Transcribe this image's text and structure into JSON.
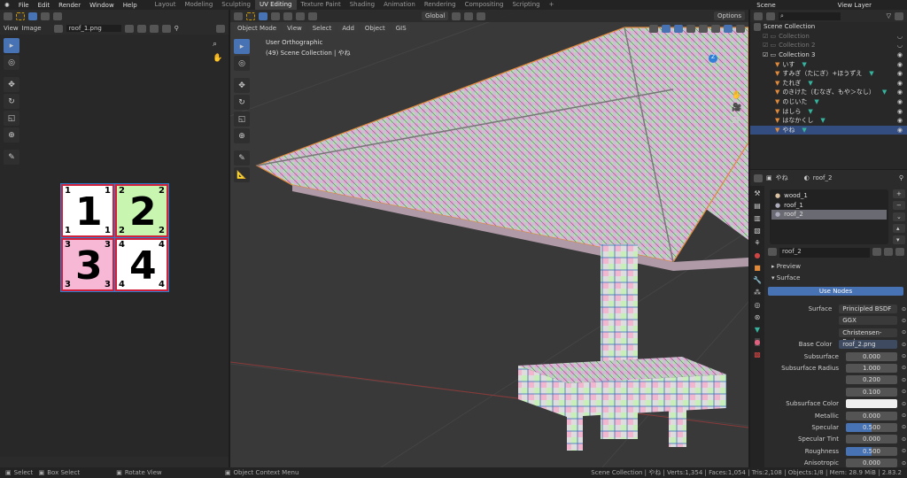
{
  "topbar": {
    "menus": [
      "File",
      "Edit",
      "Render",
      "Window",
      "Help"
    ],
    "workspaces": [
      "Layout",
      "Modeling",
      "Sculpting",
      "UV Editing",
      "Texture Paint",
      "Shading",
      "Animation",
      "Rendering",
      "Compositing",
      "Scripting"
    ],
    "active": "UV Editing",
    "scene": "Scene",
    "view_layer": "View Layer"
  },
  "uv": {
    "menus": [
      "View",
      "Image"
    ],
    "image_name": "roof_1.png",
    "quadrants": [
      "1",
      "2",
      "3",
      "4"
    ],
    "colors": {
      "q1": "#ffffff",
      "q2": "#c8f5b0",
      "q3": "#f7b8d6",
      "q4": "#ffffff"
    }
  },
  "viewport": {
    "mode": "Object Mode",
    "menus": [
      "View",
      "Select",
      "Add",
      "Object",
      "GIS"
    ],
    "orientation": "Global",
    "options": "Options",
    "view_name": "User Orthographic",
    "collection_info": "(49) Scene Collection | やね"
  },
  "outliner": {
    "root": "Scene Collection",
    "items": [
      {
        "label": "Collection",
        "dim": true
      },
      {
        "label": "Collection 2",
        "dim": true
      },
      {
        "label": "Collection 3"
      }
    ],
    "objects": [
      "いす",
      "すみぎ（たにぎ）+ほうずえ",
      "たれぎ",
      "のきけた（むなぎ、もや＞なし）",
      "のじいた",
      "はしら",
      "はなかくし",
      "やね"
    ]
  },
  "props": {
    "object": "やね",
    "material": "roof_2",
    "slots": [
      "wood_1",
      "roof_1",
      "roof_2"
    ],
    "preview": "Preview",
    "surface_section": "Surface",
    "use_nodes": "Use Nodes",
    "fields": [
      {
        "label": "Surface",
        "value": "Principled BSDF"
      },
      {
        "label": "",
        "value": "GGX"
      },
      {
        "label": "",
        "value": "Christensen-Burley"
      },
      {
        "label": "Base Color",
        "value": "roof_2.png"
      },
      {
        "label": "Subsurface",
        "value": "0.000"
      },
      {
        "label": "Subsurface Radius",
        "value": "1.000"
      },
      {
        "label": "",
        "value": "0.200"
      },
      {
        "label": "",
        "value": "0.100"
      },
      {
        "label": "Subsurface Color",
        "value": ""
      },
      {
        "label": "Metallic",
        "value": "0.000"
      },
      {
        "label": "Specular",
        "value": "0.500",
        "fill": 0.5
      },
      {
        "label": "Specular Tint",
        "value": "0.000"
      },
      {
        "label": "Roughness",
        "value": "0.500",
        "fill": 0.5
      },
      {
        "label": "Anisotropic",
        "value": "0.000"
      }
    ]
  },
  "status": {
    "select": "Select",
    "box_select": "Box Select",
    "rotate": "Rotate View",
    "context": "Object Context Menu",
    "stats": "Scene Collection | やね | Verts:1,354 | Faces:1,054 | Tris:2,108 | Objects:1/8 | Mem: 28.9 MiB | 2.83.2"
  }
}
